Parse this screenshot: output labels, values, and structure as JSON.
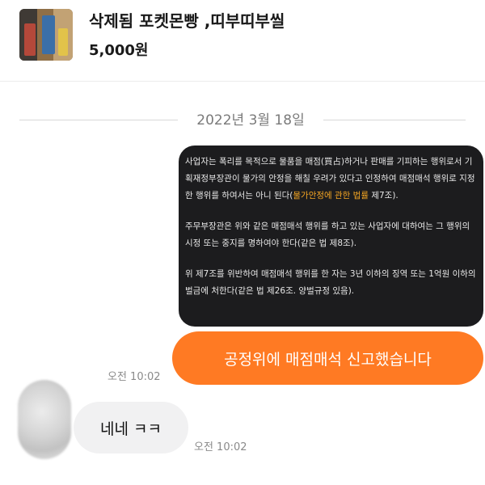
{
  "product": {
    "title": "삭제됨 포켓몬빵 ,띠부띠부씰",
    "price": "5,000원"
  },
  "chat": {
    "date": "2022년 3월 18일",
    "info_card": {
      "para1_a": "사업자는 폭리를 목적으로 물품을 매점(買占)하거나 판매를 기피하는 행위로서 기획재정부장관이 물가의 안정을 해칠 우려가 있다고 인정하여 매점매석 행위로 지정한 행위를 하여서는 아니 된다(",
      "para1_hl": "물가안정에 관한 법률",
      "para1_b": " 제7조).",
      "para2": "주무부장관은 위와 같은 매점매석 행위를 하고 있는 사업자에 대하여는 그 행위의 시정 또는 중지를 명하여야 한다(같은 법 제8조).",
      "para3": "위 제7조를 위반하여 매점매석 행위를 한 자는 3년 이하의 징역 또는 1억원 이하의 벌금에 처한다(같은 법 제26조. 양벌규정 있음).",
      "highlight_color": "#f5a623"
    },
    "sent_message": "공정위에 매점매석 신고했습니다",
    "sent_time": "오전 10:02",
    "received_message": "네네 ㅋㅋ",
    "received_time": "오전 10:02",
    "colors": {
      "sent_bubble": "#ff7a23",
      "received_bubble": "#f1f1f2",
      "card_background": "#1c1c1e"
    }
  }
}
